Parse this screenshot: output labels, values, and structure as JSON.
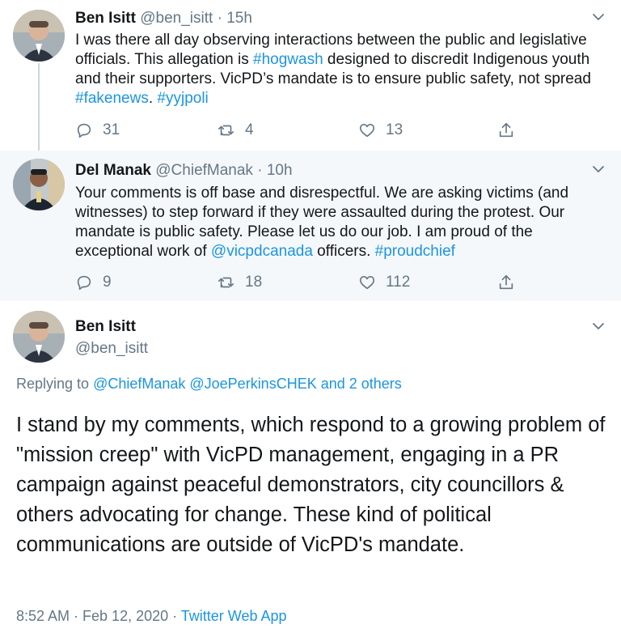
{
  "tweets": [
    {
      "name": "Ben Isitt",
      "handle": "@ben_isitt",
      "sep": " · ",
      "time": "15h",
      "text_parts": [
        {
          "t": "I was there all day observing interactions between the public and legislative officials. This allegation is ",
          "link": false
        },
        {
          "t": "#hogwash",
          "link": true
        },
        {
          "t": " designed to discredit Indigenous youth and their supporters. VicPD’s mandate is to ensure public safety, not spread ",
          "link": false
        },
        {
          "t": "#fakenews",
          "link": true
        },
        {
          "t": ". ",
          "link": false
        },
        {
          "t": "#yyjpoli",
          "link": true
        }
      ],
      "replies": "31",
      "retweets": "4",
      "likes": "13"
    },
    {
      "name": "Del Manak",
      "handle": "@ChiefManak",
      "sep": " · ",
      "time": "10h",
      "text_parts": [
        {
          "t": "Your comments is off base and disrespectful. We are asking victims (and witnesses) to step forward if they were assaulted during the protest. Our mandate is public safety. Please let us do our job. I am proud of the exceptional work of ",
          "link": false
        },
        {
          "t": "@vicpdcanada",
          "link": true
        },
        {
          "t": " officers. ",
          "link": false
        },
        {
          "t": "#proudchief",
          "link": true
        }
      ],
      "replies": "9",
      "retweets": "18",
      "likes": "112"
    }
  ],
  "main": {
    "name": "Ben Isitt",
    "handle": "@ben_isitt",
    "replying_label": "Replying to ",
    "replying_users": "@ChiefManak @JoePerkinsCHEK and 2 others",
    "text": "I stand by my comments, which respond to a growing problem of \"mission creep\" with VicPD management, engaging in a PR campaign against peaceful demonstrators, city councillors & others advocating for change. These kind of political communications are outside of VicPD's mandate.",
    "timestamp": "8:52 AM · Feb 12, 2020",
    "sep": " · ",
    "source": "Twitter Web App"
  },
  "icons": {
    "reply": "reply-icon",
    "retweet": "retweet-icon",
    "like": "like-icon",
    "share": "share-icon",
    "caret": "chevron-down-icon"
  },
  "colors": {
    "link": "#1b95e0",
    "secondary": "#657786",
    "highlight_bg": "#f5f8fa",
    "thread_line": "#ccd6dd"
  }
}
